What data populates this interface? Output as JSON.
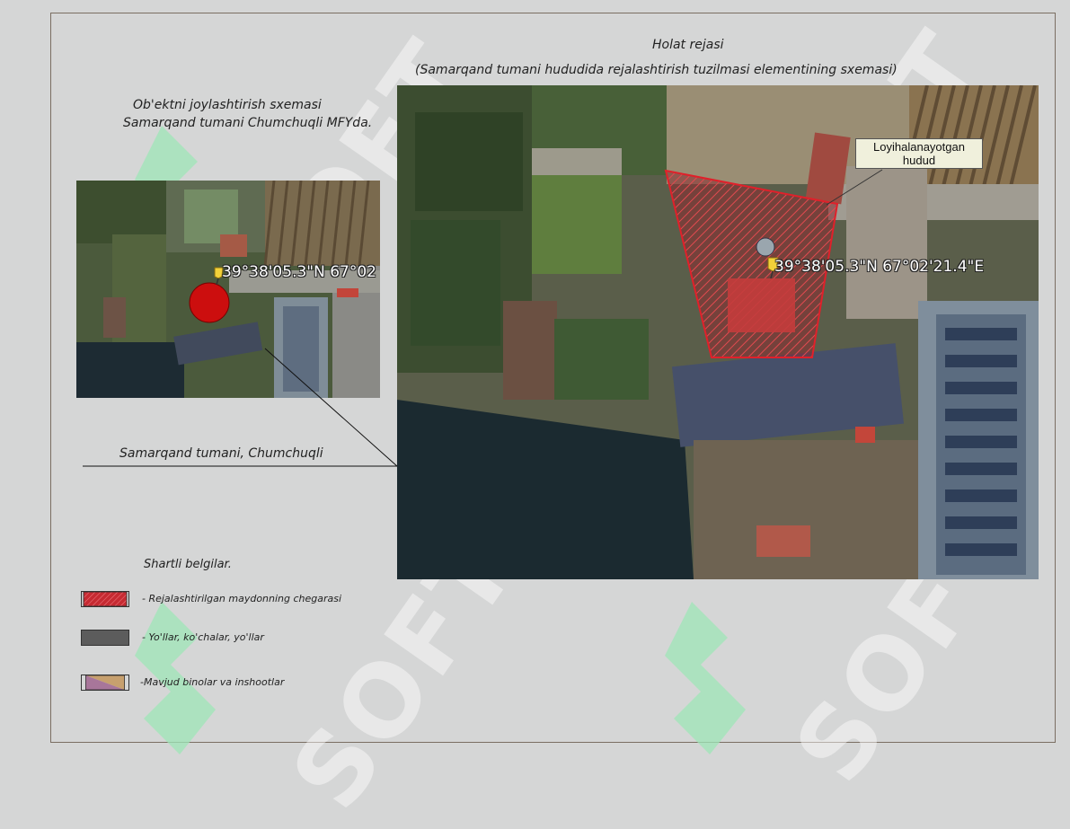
{
  "header": {
    "title": "Holat rejasi",
    "subtitle": "(Samarqand tumani hududida rejalashtirish tuzilmasi elementining sxemasi)"
  },
  "location_scheme": {
    "title_line1": "Ob'ektni joylashtirish sxemasi",
    "title_line2": "Samarqand tumani Chumchuqli MFYda.",
    "coordinate_label": "39°38'05.3\"N 67°02"
  },
  "main_map": {
    "callout_label": "Loyihalanayotgan hudud",
    "coordinate_label": "39°38'05.3\"N 67°02'21.4\"E"
  },
  "place_label": "Samarqand tumani, Chumchuqli",
  "legend": {
    "title": "Shartli belgilar.",
    "items": [
      {
        "text": "- Rejalashtirilgan maydonning chegarasi",
        "color": "#d8323c"
      },
      {
        "text": "- Yo'llar, ko'chalar, yo'llar",
        "color": "#5c5c5c"
      },
      {
        "text": "-Mavjud binolar va inshootlar",
        "color": "#c7a06e"
      }
    ]
  },
  "watermark": {
    "text": "SOFT"
  },
  "colors": {
    "boundary": "#e0202a",
    "background": "#d5d6d6",
    "frame": "#7a6e62"
  }
}
